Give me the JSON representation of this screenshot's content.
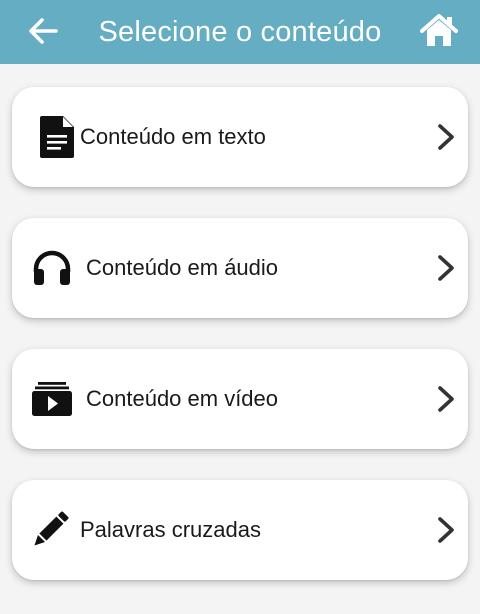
{
  "header": {
    "title": "Selecione o conteúdo",
    "back_icon": "arrow-left-icon",
    "home_icon": "home-icon",
    "background_color": "#64adc2",
    "text_color": "#ffffff"
  },
  "menu": {
    "items": [
      {
        "label": "Conteúdo em texto",
        "icon": "document-icon"
      },
      {
        "label": "Conteúdo em áudio",
        "icon": "headphones-icon"
      },
      {
        "label": "Conteúdo em vídeo",
        "icon": "video-icon"
      },
      {
        "label": "Palavras cruzadas",
        "icon": "pencil-icon"
      }
    ],
    "trailing_icon": "chevron-right-icon"
  }
}
